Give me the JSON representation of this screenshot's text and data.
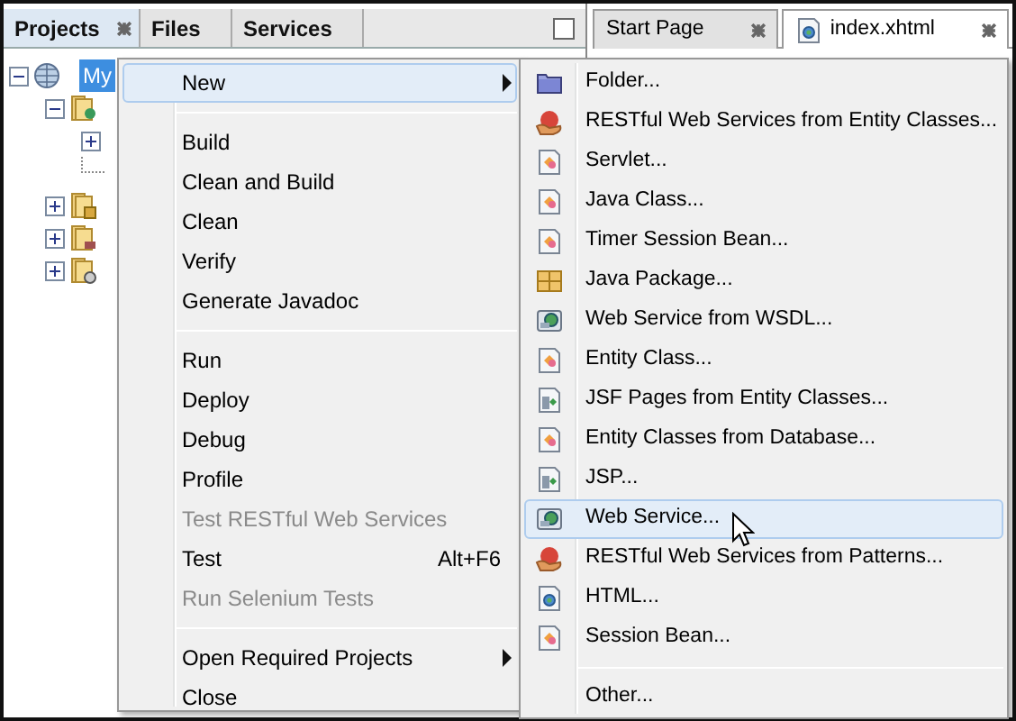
{
  "left_panel": {
    "tabs": [
      {
        "label": "Projects",
        "selected": true,
        "closable": true
      },
      {
        "label": "Files",
        "selected": false,
        "closable": false
      },
      {
        "label": "Services",
        "selected": false,
        "closable": false
      }
    ]
  },
  "tree": {
    "label": "My",
    "selected": true,
    "expanded": true,
    "children": [
      {
        "kind": "web",
        "expanded": true,
        "children": [
          {
            "kind": "node",
            "expanded": false
          },
          {
            "kind": "leaf"
          }
        ]
      },
      {
        "kind": "package",
        "expanded": false
      },
      {
        "kind": "library",
        "expanded": false
      },
      {
        "kind": "config",
        "expanded": false
      }
    ]
  },
  "editor_tabs": [
    {
      "label": "Start Page",
      "selected": false,
      "closable": true,
      "kind": "plain"
    },
    {
      "label": "index.xhtml",
      "selected": true,
      "closable": true,
      "kind": "html"
    }
  ],
  "context_menu": [
    {
      "kind": "submenu",
      "label": "New",
      "selected": true,
      "disabled": false
    },
    {
      "kind": "separator"
    },
    {
      "kind": "item",
      "label": "Build",
      "selected": false,
      "disabled": false
    },
    {
      "kind": "item",
      "label": "Clean and Build",
      "selected": false,
      "disabled": false
    },
    {
      "kind": "item",
      "label": "Clean",
      "selected": false,
      "disabled": false
    },
    {
      "kind": "item",
      "label": "Verify",
      "selected": false,
      "disabled": false
    },
    {
      "kind": "item",
      "label": "Generate Javadoc",
      "selected": false,
      "disabled": false
    },
    {
      "kind": "separator"
    },
    {
      "kind": "item",
      "label": "Run",
      "selected": false,
      "disabled": false
    },
    {
      "kind": "item",
      "label": "Deploy",
      "selected": false,
      "disabled": false
    },
    {
      "kind": "item",
      "label": "Debug",
      "selected": false,
      "disabled": false
    },
    {
      "kind": "item",
      "label": "Profile",
      "selected": false,
      "disabled": false
    },
    {
      "kind": "item",
      "label": "Test RESTful Web Services",
      "selected": false,
      "disabled": true
    },
    {
      "kind": "item",
      "label": "Test",
      "shortcut": "Alt+F6",
      "selected": false,
      "disabled": false
    },
    {
      "kind": "item",
      "label": "Run Selenium Tests",
      "selected": false,
      "disabled": true
    },
    {
      "kind": "separator"
    },
    {
      "kind": "submenu",
      "label": "Open Required Projects",
      "selected": false,
      "disabled": false
    },
    {
      "kind": "item",
      "label": "Close",
      "selected": false,
      "disabled": false
    }
  ],
  "new_submenu": [
    {
      "kind": "folder",
      "label": "Folder...",
      "selected": false
    },
    {
      "kind": "rest",
      "label": "RESTful Web Services from Entity Classes...",
      "selected": false
    },
    {
      "kind": "class",
      "label": "Servlet...",
      "selected": false
    },
    {
      "kind": "class",
      "label": "Java Class...",
      "selected": false
    },
    {
      "kind": "class",
      "label": "Timer Session Bean...",
      "selected": false
    },
    {
      "kind": "package",
      "label": "Java Package...",
      "selected": false
    },
    {
      "kind": "service",
      "label": "Web Service from WSDL...",
      "selected": false
    },
    {
      "kind": "class",
      "label": "Entity Class...",
      "selected": false
    },
    {
      "kind": "page",
      "label": "JSF Pages from Entity Classes...",
      "selected": false
    },
    {
      "kind": "class",
      "label": "Entity Classes from Database...",
      "selected": false
    },
    {
      "kind": "page",
      "label": "JSP...",
      "selected": false
    },
    {
      "kind": "service",
      "label": "Web Service...",
      "selected": true
    },
    {
      "kind": "rest",
      "label": "RESTful Web Services from Patterns...",
      "selected": false
    },
    {
      "kind": "html",
      "label": "HTML...",
      "selected": false
    },
    {
      "kind": "class",
      "label": "Session Bean...",
      "selected": false
    },
    {
      "kind": "separator"
    },
    {
      "kind": "other",
      "label": "Other...",
      "selected": false
    }
  ]
}
